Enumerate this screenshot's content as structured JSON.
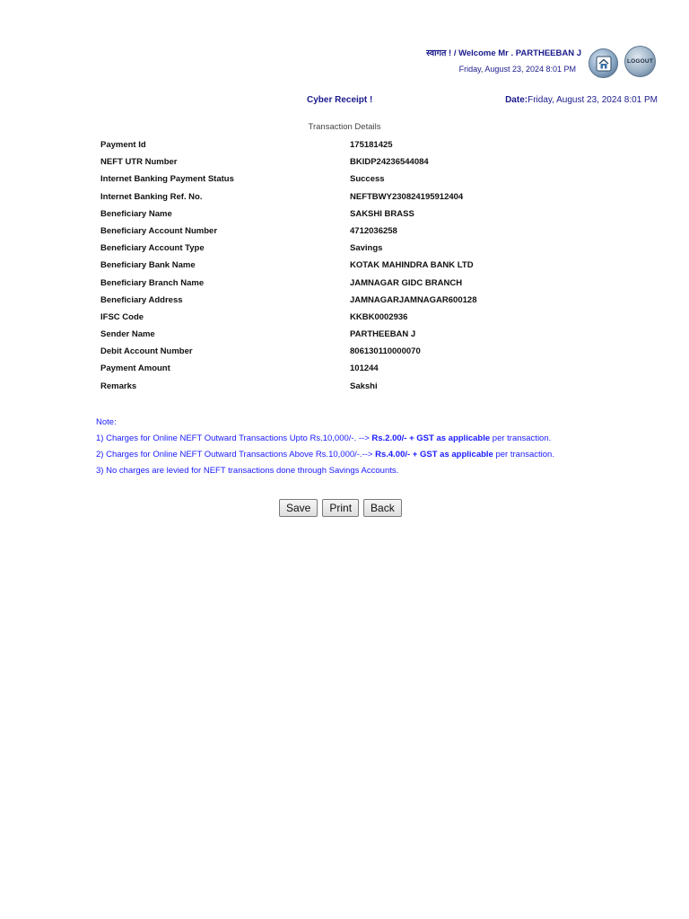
{
  "header": {
    "welcome": "स्वागत ! / Welcome Mr . PARTHEEBAN J",
    "datetime": "Friday, August 23, 2024 8:01 PM",
    "logout_label": "LOGOUT"
  },
  "receipt": {
    "title": "Cyber Receipt !",
    "date_label": "Date:",
    "date_value": "Friday, August 23, 2024 8:01 PM",
    "section_title": "Transaction Details",
    "rows": [
      {
        "label": "Payment Id",
        "value": "175181425"
      },
      {
        "label": "NEFT UTR Number",
        "value": "BKIDP24236544084"
      },
      {
        "label": "Internet Banking Payment Status",
        "value": "Success"
      },
      {
        "label": "Internet Banking Ref. No.",
        "value": "NEFTBWY230824195912404"
      },
      {
        "label": "Beneficiary Name",
        "value": "SAKSHI BRASS"
      },
      {
        "label": "Beneficiary Account Number",
        "value": "4712036258"
      },
      {
        "label": "Beneficiary Account Type",
        "value": "Savings"
      },
      {
        "label": "Beneficiary Bank Name",
        "value": "KOTAK MAHINDRA BANK LTD"
      },
      {
        "label": "Beneficiary Branch Name",
        "value": "JAMNAGAR GIDC BRANCH"
      },
      {
        "label": "Beneficiary Address",
        "value": "JAMNAGARJAMNAGAR600128"
      },
      {
        "label": "IFSC Code",
        "value": "KKBK0002936"
      },
      {
        "label": "Sender Name",
        "value": "PARTHEEBAN J"
      },
      {
        "label": "Debit Account Number",
        "value": "806130110000070"
      },
      {
        "label": "Payment Amount",
        "value": "101244"
      },
      {
        "label": "Remarks",
        "value": "Sakshi"
      }
    ]
  },
  "notes": {
    "heading": "Note:",
    "line1_prefix": "1) Charges for Online NEFT Outward Transactions Upto Rs.10,000/-. -->",
    "line1_bold": "Rs.2.00/- + GST as applicable",
    "line1_suffix": "per transaction.",
    "line2_prefix": "2) Charges for Online NEFT Outward Transactions Above Rs.10,000/-.-->",
    "line2_bold": "Rs.4.00/- + GST as applicable",
    "line2_suffix": "per transaction.",
    "line3": "3) No charges are levied for NEFT transactions done through Savings Accounts."
  },
  "buttons": {
    "save": "Save",
    "print": "Print",
    "back": "Back"
  },
  "icons": {
    "home": "home-icon",
    "logout": "logout-icon"
  },
  "colors": {
    "header_text": "#1a1a8c",
    "note_text": "#1a1aff"
  }
}
